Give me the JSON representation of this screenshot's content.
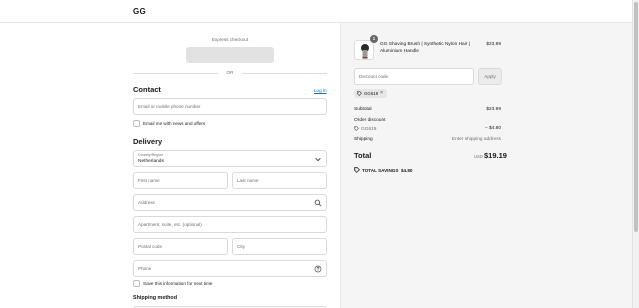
{
  "header": {
    "logo": "GG"
  },
  "express": {
    "label": "Express checkout",
    "divider": "OR"
  },
  "contact": {
    "heading": "Contact",
    "login_link": "Log in",
    "email_placeholder": "Email or mobile phone number",
    "newsletter_label": "Email me with news and offers"
  },
  "delivery": {
    "heading": "Delivery",
    "country_label": "Country/Region",
    "country_value": "Netherlands",
    "first_name": "First name",
    "last_name": "Last name",
    "address": "Address",
    "apartment": "Apartment, suite, etc. (optional)",
    "postal_code": "Postal code",
    "city": "City",
    "phone": "Phone",
    "save_info_label": "Save this information for next time"
  },
  "shipping_method": {
    "heading": "Shipping method"
  },
  "order": {
    "product_name": "GG Shaving Brush | Synthetic Nylon Hair | Aluminium Handle",
    "product_price": "$23.99",
    "quantity": "1",
    "discount_placeholder": "Discount code",
    "apply_label": "Apply",
    "applied_code": "GG619",
    "subtotal_label": "Subtotal",
    "subtotal_value": "$23.99",
    "order_discount_label": "Order discount",
    "discount_code": "GG619",
    "discount_value": "− $4.80",
    "shipping_label": "Shipping",
    "shipping_value": "Enter shipping address",
    "total_label": "Total",
    "total_currency": "USD",
    "total_value": "$19.19",
    "savings_label": "TOTAL SAVINGS",
    "savings_value": "$4.80"
  },
  "icons": {
    "search": "search-icon",
    "help": "question-circle-icon",
    "chevron": "chevron-down-icon",
    "tag": "tag-icon",
    "close": "close-icon"
  },
  "colors": {
    "link": "#1773b0",
    "summary_bg": "#f5f5f5"
  }
}
